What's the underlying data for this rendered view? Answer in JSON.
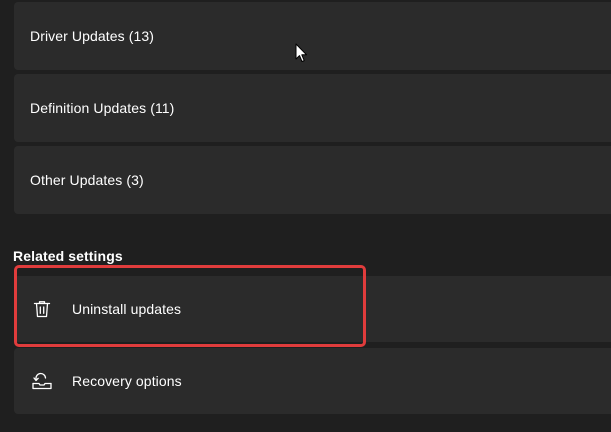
{
  "update_categories": [
    {
      "label": "Driver Updates (13)"
    },
    {
      "label": "Definition Updates (11)"
    },
    {
      "label": "Other Updates (3)"
    }
  ],
  "related_settings": {
    "title": "Related settings",
    "items": [
      {
        "label": "Uninstall updates",
        "icon": "trash-icon"
      },
      {
        "label": "Recovery options",
        "icon": "recovery-icon"
      }
    ]
  },
  "colors": {
    "background": "#1f1f1f",
    "card": "#2b2b2b",
    "highlight": "#e03c3c",
    "text": "#ffffff"
  }
}
